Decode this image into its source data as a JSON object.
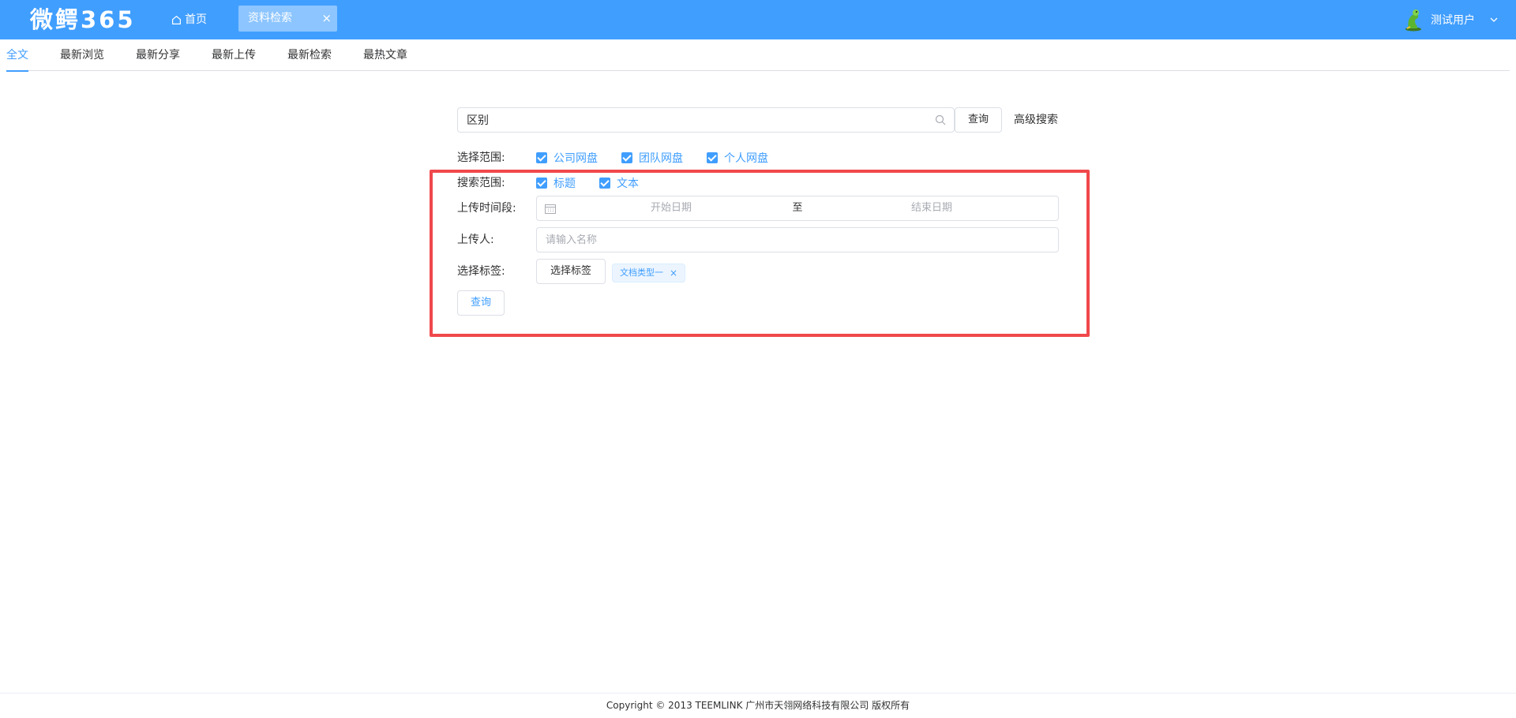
{
  "header": {
    "logo": "微鳄365",
    "home_label": "首页",
    "active_tab": "资料检索",
    "tab_close": "×",
    "user_name": "测试用户"
  },
  "subnav": {
    "items": [
      "全文",
      "最新浏览",
      "最新分享",
      "最新上传",
      "最新检索",
      "最热文章"
    ],
    "active_index": 0
  },
  "search": {
    "value": "区别",
    "button": "查询",
    "advanced_link": "高级搜索"
  },
  "scope": {
    "label": "选择范围:",
    "options": [
      {
        "label": "公司网盘",
        "checked": true
      },
      {
        "label": "团队网盘",
        "checked": true
      },
      {
        "label": "个人网盘",
        "checked": true
      }
    ]
  },
  "advanced": {
    "search_range_label": "搜索范围:",
    "search_range_options": [
      {
        "label": "标题",
        "checked": true
      },
      {
        "label": "文本",
        "checked": true
      }
    ],
    "upload_time_label": "上传时间段:",
    "start_placeholder": "开始日期",
    "range_separator": "至",
    "end_placeholder": "结束日期",
    "uploader_label": "上传人:",
    "uploader_placeholder": "请输入名称",
    "tags_label": "选择标签:",
    "choose_tag_button": "选择标签",
    "selected_tags": [
      "文档类型一"
    ],
    "query_button": "查询"
  },
  "footer": {
    "text": "Copyright © 2013 TEEMLINK 广州市天翎网络科技有限公司 版权所有"
  },
  "colors": {
    "primary": "#409EFF",
    "highlight": "#f0484b"
  }
}
